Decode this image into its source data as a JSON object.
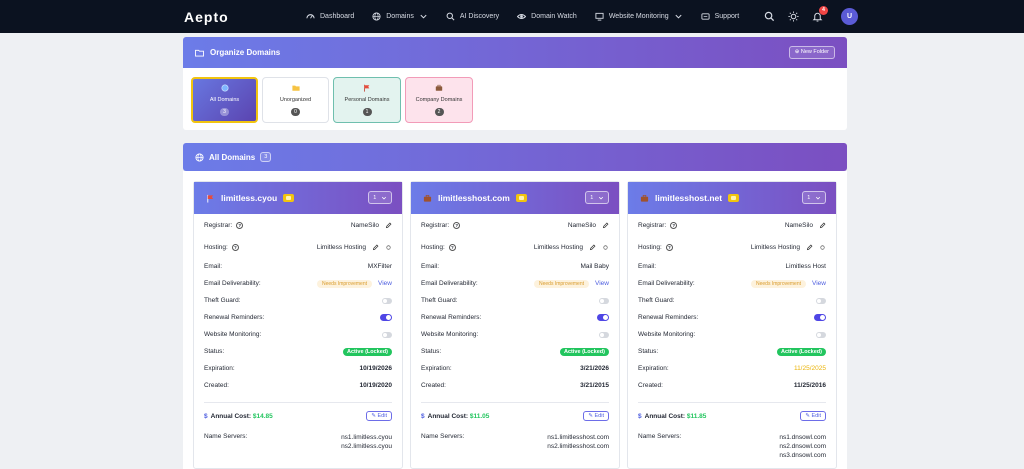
{
  "nav": {
    "logo": "Aepto",
    "items": [
      {
        "label": "Dashboard",
        "icon": "dashboard-icon"
      },
      {
        "label": "Domains",
        "icon": "globe-icon",
        "dropdown": true
      },
      {
        "label": "AI Discovery",
        "icon": "search-icon"
      },
      {
        "label": "Domain Watch",
        "icon": "eye-icon"
      },
      {
        "label": "Website Monitoring",
        "icon": "monitor-icon",
        "dropdown": true
      },
      {
        "label": "Support",
        "icon": "support-icon"
      }
    ],
    "notification_count": "4",
    "avatar_initial": "U"
  },
  "organize": {
    "title": "Organize Domains",
    "new_folder": "New Folder",
    "folders": [
      {
        "label": "All Domains",
        "count": "3"
      },
      {
        "label": "Unorganized",
        "count": "0"
      },
      {
        "label": "Personal Domains",
        "count": "1"
      },
      {
        "label": "Company Domains",
        "count": "2"
      }
    ]
  },
  "all_domains": {
    "title": "All Domains",
    "count": "3"
  },
  "labels": {
    "registrar": "Registrar:",
    "hosting": "Hosting:",
    "email": "Email:",
    "deliverability": "Email Deliverability:",
    "theft_guard": "Theft Guard:",
    "renewal": "Renewal Reminders:",
    "monitoring": "Website Monitoring:",
    "status": "Status:",
    "expiration": "Expiration:",
    "created": "Created:",
    "annual_cost": "Annual Cost:",
    "name_servers": "Name Servers:",
    "edit": "Edit",
    "needs_improvement": "Needs Improvement",
    "view": "View",
    "status_value": "Active (Locked)"
  },
  "cards": [
    {
      "domain": "limitless.cyou",
      "icon": "flag-icon",
      "select": "1",
      "registrar": "NameSilo",
      "hosting": "Limitless Hosting",
      "email": "MXFilter",
      "expiration": "10/19/2026",
      "created": "10/19/2020",
      "cost": "$14.85",
      "ns": [
        "ns1.limitless.cyou",
        "ns2.limitless.cyou"
      ]
    },
    {
      "domain": "limitlesshost.com",
      "icon": "briefcase-icon",
      "select": "1",
      "registrar": "NameSilo",
      "hosting": "Limitless Hosting",
      "email": "Mail Baby",
      "expiration": "3/21/2026",
      "created": "3/21/2015",
      "cost": "$11.05",
      "ns": [
        "ns1.limitlesshost.com",
        "ns2.limitlesshost.com"
      ]
    },
    {
      "domain": "limitlesshost.net",
      "icon": "briefcase-icon",
      "select": "1",
      "registrar": "NameSilo",
      "hosting": "Limitless Hosting",
      "email": "Limitless Host",
      "expiration": "11/25/2025",
      "created": "11/25/2016",
      "cost": "$11.85",
      "ns": [
        "ns1.dnsowl.com",
        "ns2.dnsowl.com",
        "ns3.dnsowl.com"
      ]
    }
  ],
  "colors": {
    "accent": "#4f46e5",
    "success": "#22c55e",
    "warning": "#eab308",
    "nav_bg": "#0b1220"
  }
}
